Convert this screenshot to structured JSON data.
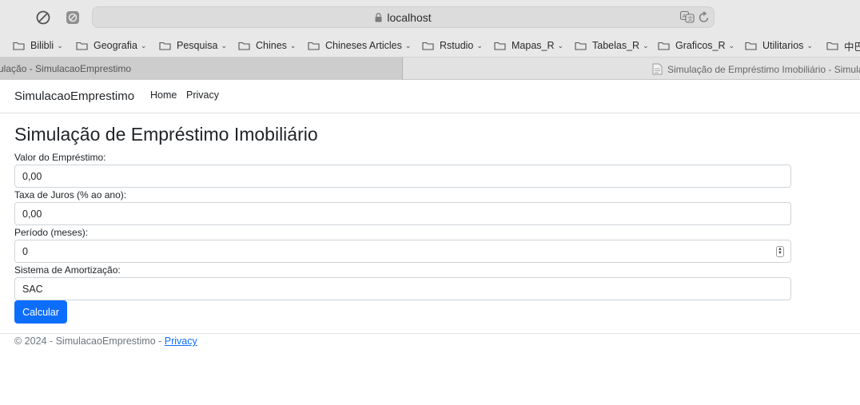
{
  "browser": {
    "url": "localhost",
    "bookmarks": [
      {
        "label": "Bilibli"
      },
      {
        "label": "Geografia"
      },
      {
        "label": "Pesquisa"
      },
      {
        "label": "Chines"
      },
      {
        "label": "Chineses Articles"
      },
      {
        "label": "Rstudio"
      },
      {
        "label": "Mapas_R"
      },
      {
        "label": "Tabelas_R"
      },
      {
        "label": "Graficos_R"
      },
      {
        "label": "Utilitarios"
      },
      {
        "label": "中巴"
      }
    ],
    "tabs": [
      {
        "title": "ulação - SimulacaoEmprestimo",
        "active": true
      },
      {
        "title": "Simulação de Empréstimo Imobiliário - Simula",
        "active": false
      }
    ]
  },
  "navbar": {
    "brand": "SimulacaoEmprestimo",
    "links": [
      "Home",
      "Privacy"
    ]
  },
  "form": {
    "title": "Simulação de Empréstimo Imobiliário",
    "fields": [
      {
        "label": "Valor do Empréstimo:",
        "value": "0,00"
      },
      {
        "label": "Taxa de Juros (% ao ano):",
        "value": "0,00"
      },
      {
        "label": "Período (meses):",
        "value": "0"
      },
      {
        "label": "Sistema de Amortização:",
        "value": "SAC"
      }
    ],
    "submit_label": "Calcular"
  },
  "footer": {
    "text": "© 2024 - SimulacaoEmprestimo - ",
    "link": "Privacy"
  },
  "colors": {
    "primary": "#0d6efd",
    "toolbar_bg": "#e8e8e8"
  }
}
